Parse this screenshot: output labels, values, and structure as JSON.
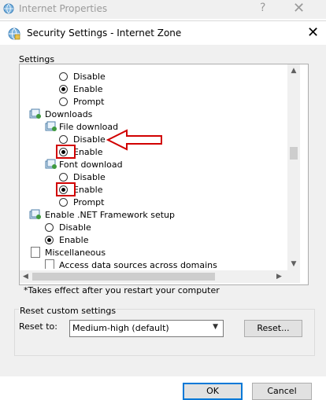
{
  "parent_window": {
    "title": "Internet Properties",
    "help": "?",
    "close": "✕"
  },
  "dialog": {
    "title": "Security Settings - Internet Zone",
    "close": "✕"
  },
  "settings_label": "Settings",
  "tree": {
    "top_options": [
      {
        "label": "Disable",
        "selected": false
      },
      {
        "label": "Enable",
        "selected": true
      },
      {
        "label": "Prompt",
        "selected": false
      }
    ],
    "downloads": {
      "label": "Downloads"
    },
    "file_download": {
      "label": "File download",
      "options": [
        {
          "label": "Disable",
          "selected": false
        },
        {
          "label": "Enable",
          "selected": true
        }
      ]
    },
    "font_download": {
      "label": "Font download",
      "options": [
        {
          "label": "Disable",
          "selected": false
        },
        {
          "label": "Enable",
          "selected": true
        },
        {
          "label": "Prompt",
          "selected": false
        }
      ]
    },
    "net_setup": {
      "label": "Enable .NET Framework setup",
      "options": [
        {
          "label": "Disable",
          "selected": false
        },
        {
          "label": "Enable",
          "selected": true
        }
      ]
    },
    "misc": {
      "label": "Miscellaneous"
    },
    "cut_item": {
      "label": "Access data sources across domains"
    }
  },
  "note": "*Takes effect after you restart your computer",
  "reset": {
    "group_label": "Reset custom settings",
    "reset_to_label": "Reset to:",
    "selected_level": "Medium-high (default)",
    "reset_button": "Reset..."
  },
  "buttons": {
    "ok": "OK",
    "cancel": "Cancel"
  },
  "colors": {
    "highlight": "#d10000",
    "accent": "#0078d7"
  }
}
